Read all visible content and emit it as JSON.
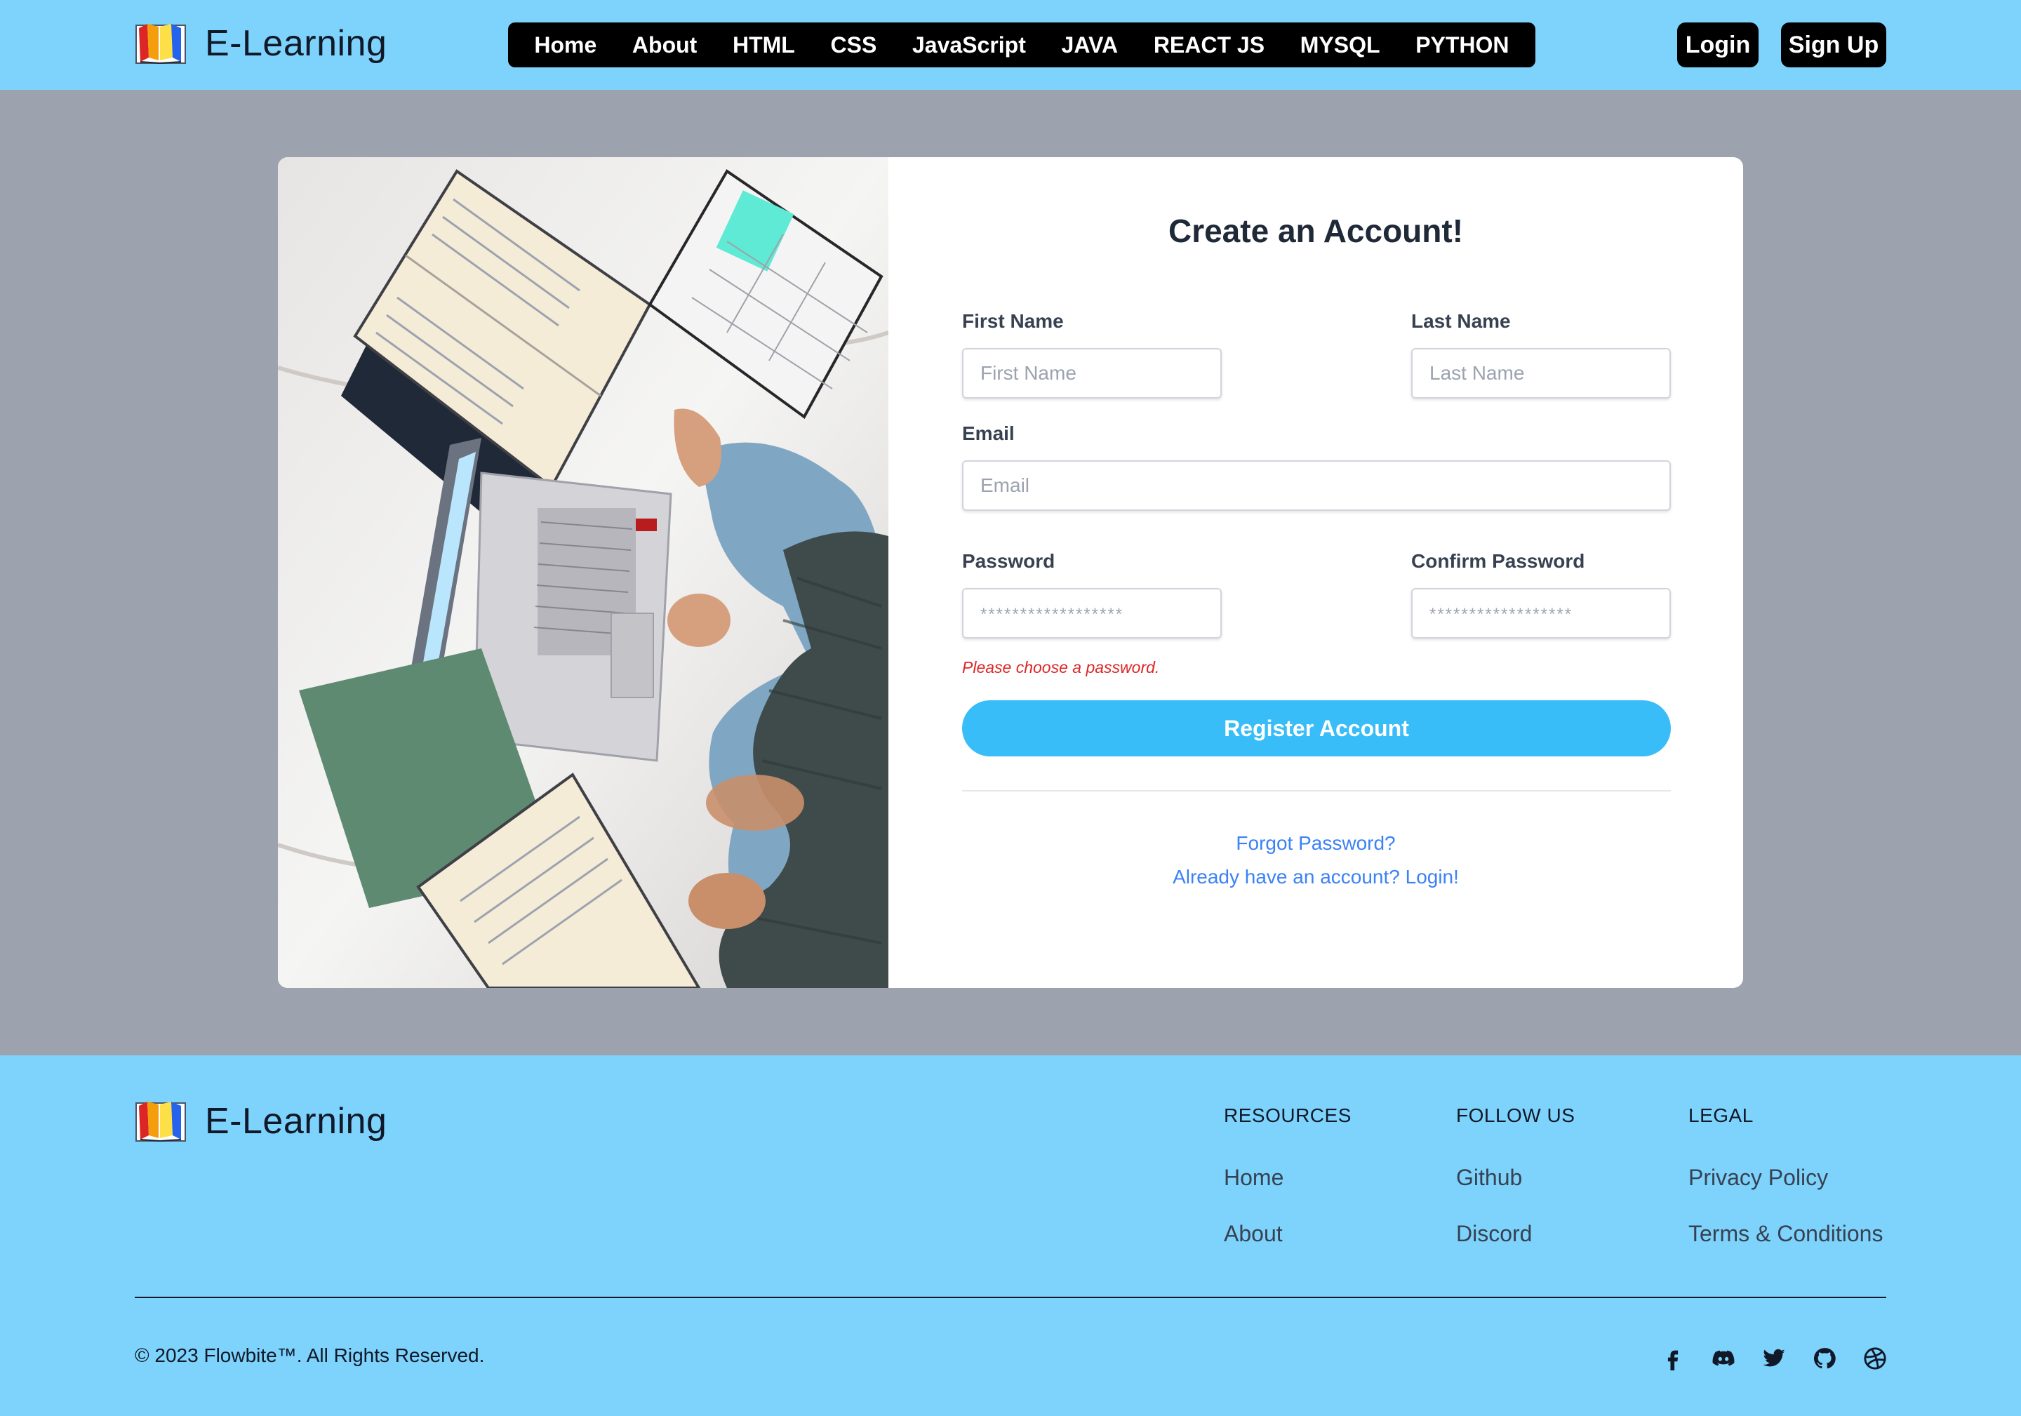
{
  "header": {
    "brand": "E-Learning",
    "nav": [
      "Home",
      "About",
      "HTML",
      "CSS",
      "JavaScript",
      "JAVA",
      "REACT JS",
      "MYSQL",
      "PYTHON"
    ],
    "login_label": "Login",
    "signup_label": "Sign Up"
  },
  "form": {
    "title": "Create an Account!",
    "first_name": {
      "label": "First Name",
      "placeholder": "First Name"
    },
    "last_name": {
      "label": "Last Name",
      "placeholder": "Last Name"
    },
    "email": {
      "label": "Email",
      "placeholder": "Email"
    },
    "password": {
      "label": "Password",
      "placeholder": "******************"
    },
    "confirm_password": {
      "label": "Confirm Password",
      "placeholder": "******************"
    },
    "error": "Please choose a password.",
    "register_label": "Register Account",
    "forgot_link": "Forgot Password?",
    "login_link": "Already have an account? Login!"
  },
  "footer": {
    "brand": "E-Learning",
    "columns": [
      {
        "heading": "RESOURCES",
        "links": [
          "Home",
          "About"
        ]
      },
      {
        "heading": "FOLLOW US",
        "links": [
          "Github",
          "Discord"
        ]
      },
      {
        "heading": "LEGAL",
        "links": [
          "Privacy Policy",
          "Terms & Conditions"
        ]
      }
    ],
    "copyright": "© 2023 Flowbite™. All Rights Reserved.",
    "social_icons": [
      "facebook-icon",
      "discord-icon",
      "twitter-icon",
      "github-icon",
      "dribbble-icon"
    ]
  },
  "colors": {
    "header_bg": "#7dd3fc",
    "page_bg": "#9ca3af",
    "accent_button": "#38bdf8",
    "link": "#3b82f6",
    "error": "#dc2626"
  }
}
